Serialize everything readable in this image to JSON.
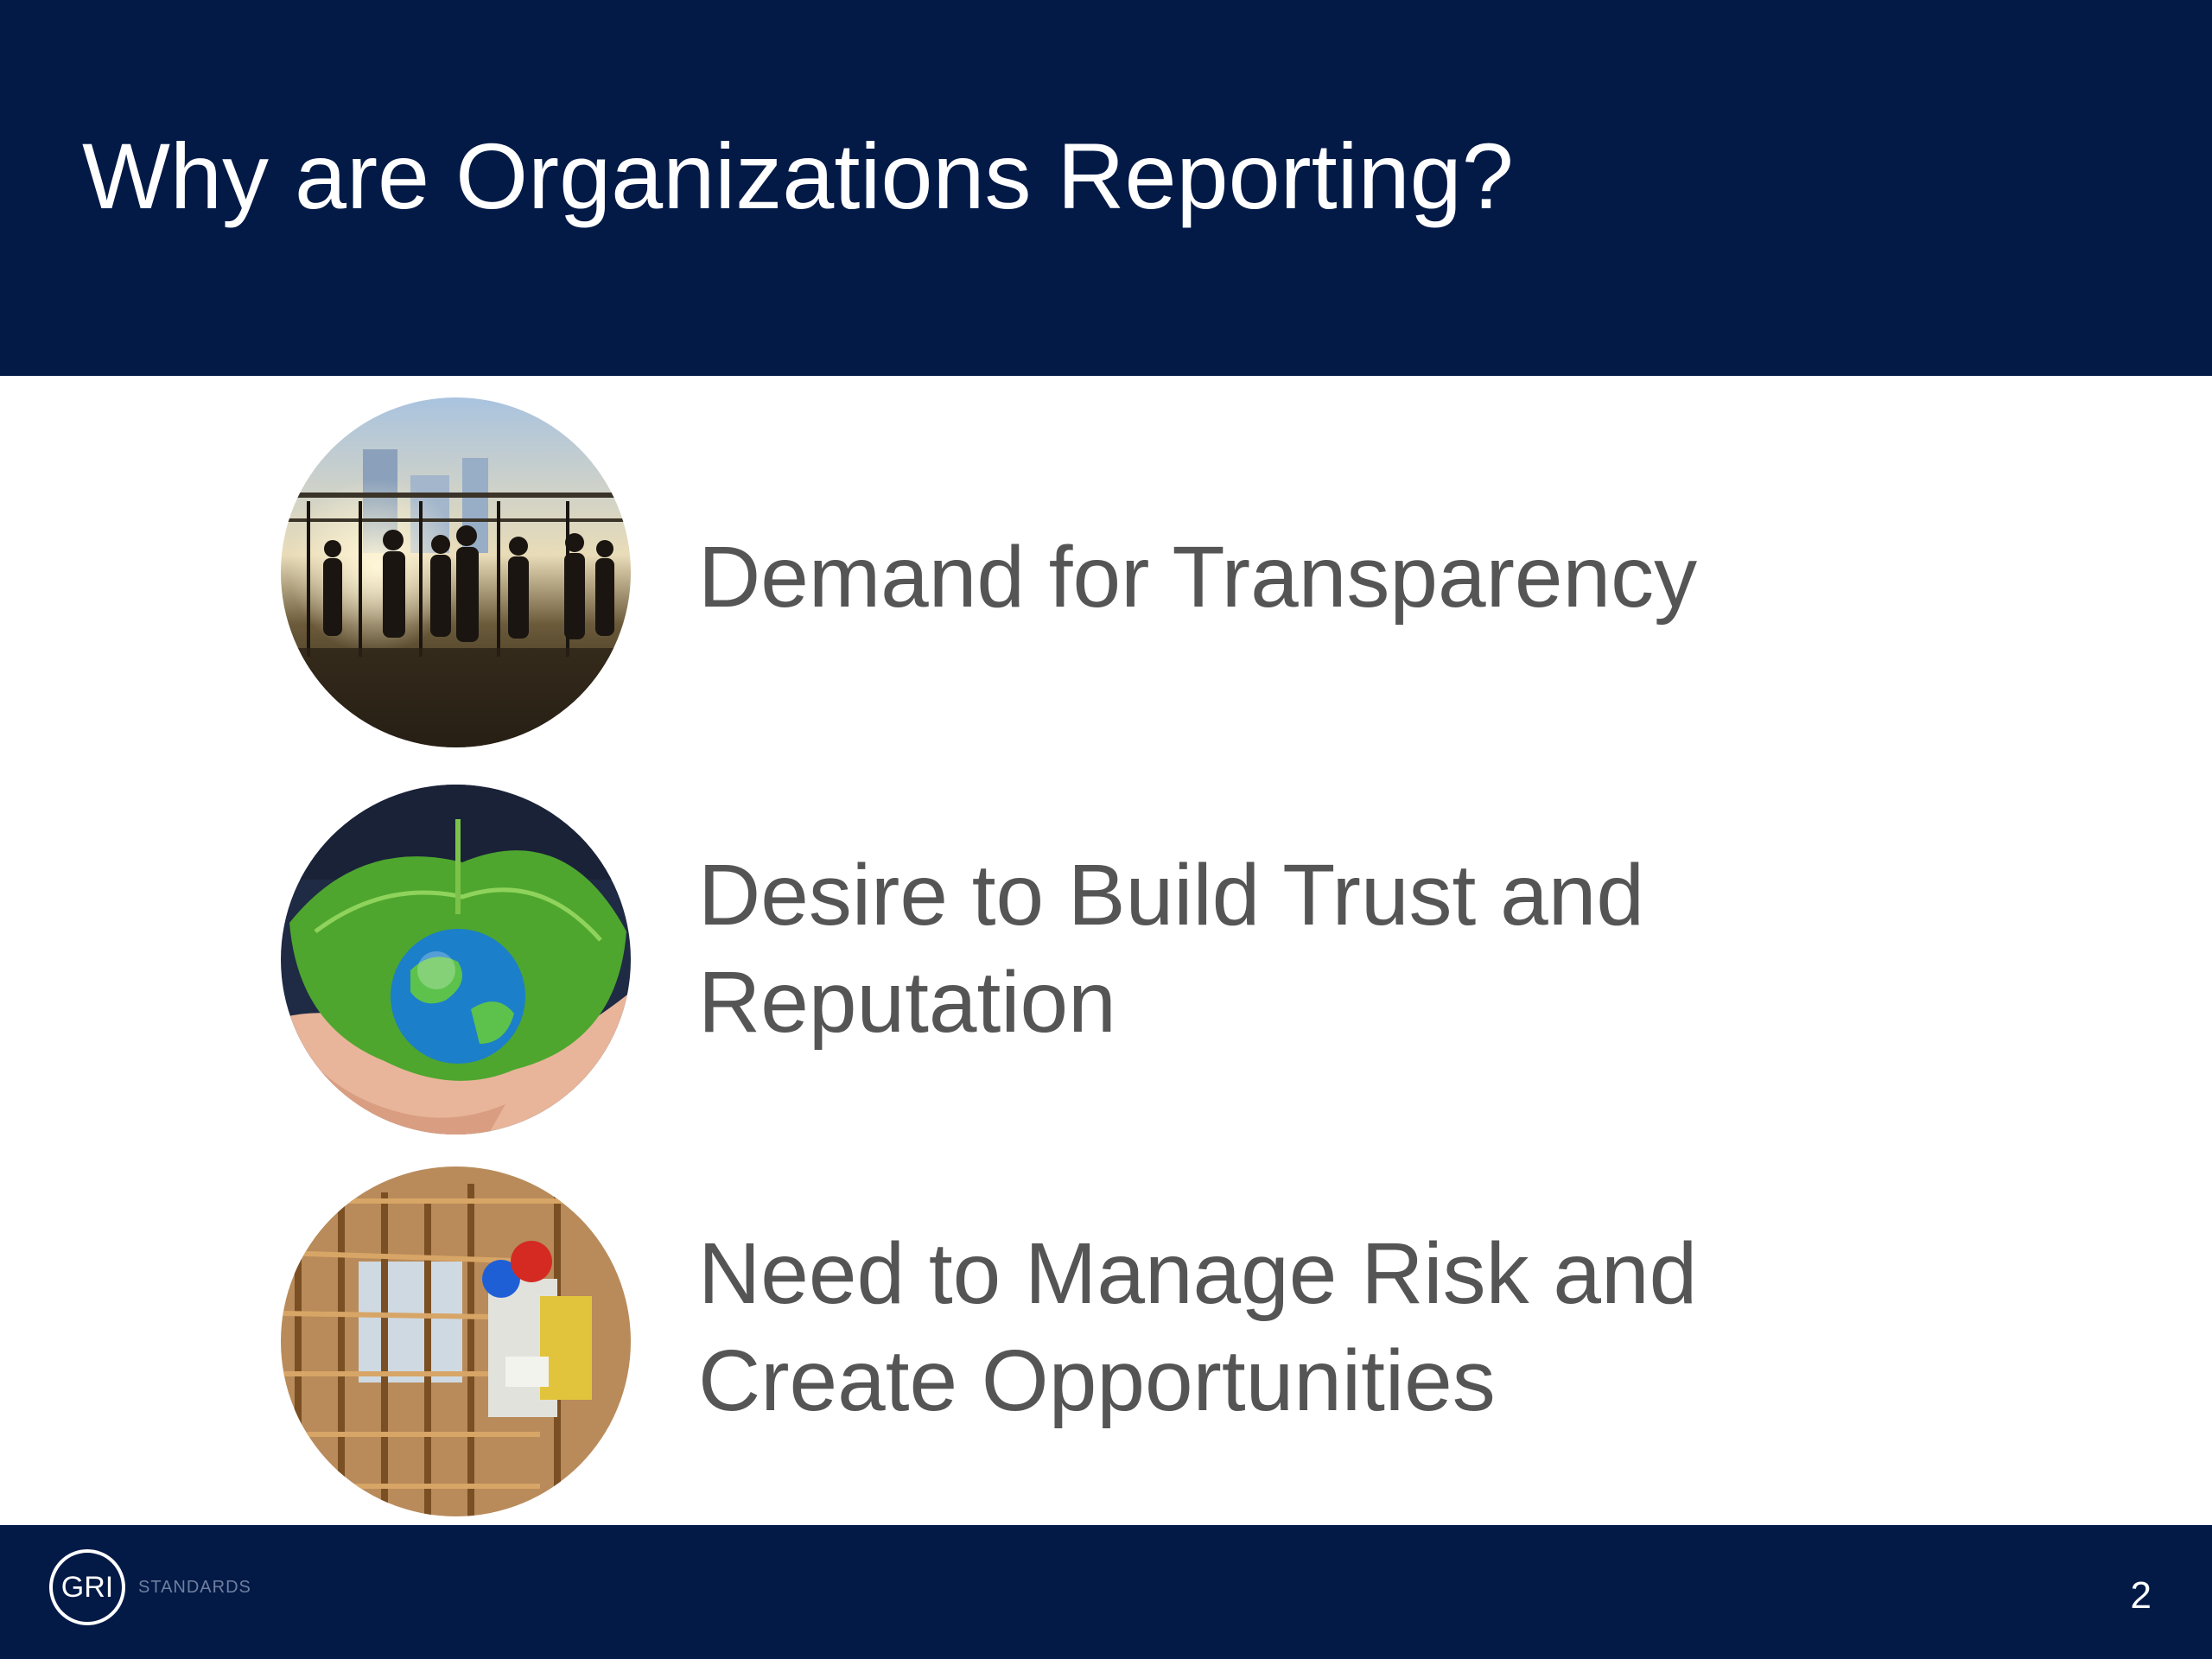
{
  "slide": {
    "title": "Why are Organizations Reporting?",
    "items": [
      {
        "line1": "Demand for Transparency",
        "line2": "",
        "image": "business-people-silhouette-image"
      },
      {
        "line1": "Desire to Build Trust and",
        "line2": "Reputation",
        "image": "hands-leaf-globe-image"
      },
      {
        "line1": "Need to Manage Risk and",
        "line2": "Create Opportunities",
        "image": "construction-workers-scaffolding-image"
      }
    ],
    "page_number": "2"
  },
  "footer": {
    "logo_text": "GRI",
    "logo_sub": "STANDARDS"
  },
  "colors": {
    "header_bg": "#031a47",
    "body_text": "#555555"
  }
}
